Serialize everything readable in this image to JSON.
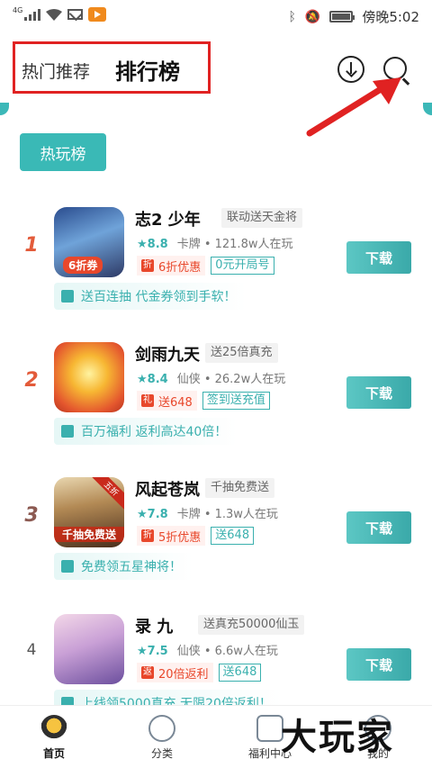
{
  "status_bar": {
    "network": "4G",
    "time": "傍晚5:02",
    "icons": [
      "signal-icon",
      "wifi-icon",
      "mail-icon",
      "app-notification-icon",
      "bluetooth-icon",
      "mute-bell-icon",
      "battery-icon"
    ]
  },
  "header": {
    "tab_hot": "热门推荐",
    "tab_rank": "排行榜",
    "download_icon": "download-circle-icon",
    "search_icon": "search-icon"
  },
  "section": {
    "tab_label": "热玩榜"
  },
  "games": [
    {
      "rank": "1",
      "name": "志2    少年",
      "tag": "联动送天金将",
      "score": "8.8",
      "category": "卡牌 • 121.8w人在玩",
      "perk_icon": "折",
      "perk": "6折优惠",
      "perk_sub": "0元开局号",
      "promo": "送百连抽 代金券领到手软！",
      "icon_text": "6折券",
      "button": "下载"
    },
    {
      "rank": "2",
      "name": "剑雨九天",
      "tag": "送25倍真充",
      "score": "8.4",
      "category": "仙侠 • 26.2w人在玩",
      "perk_icon": "礼",
      "perk": "送648",
      "perk_sub": "签到送充值",
      "promo": "百万福利 返利高达40倍！",
      "icon_text": "",
      "button": "下载"
    },
    {
      "rank": "3",
      "name": "风起苍岚",
      "tag": "千抽免费送",
      "score": "7.8",
      "category": "卡牌 • 1.3w人在玩",
      "perk_icon": "折",
      "perk": "5折优惠",
      "perk_sub": "送648",
      "promo": "免费领五星神将！",
      "icon_text": "千抽免费送",
      "icon_ribbon": "五折",
      "button": "下载"
    },
    {
      "rank": "4",
      "name": "录    九",
      "tag": "送真充50000仙玉",
      "score": "7.5",
      "category": "仙侠 • 6.6w人在玩",
      "perk_icon": "返",
      "perk": "20倍返利",
      "perk_sub": "送648",
      "promo": "上线领5000真充 无限20倍返利！",
      "icon_text": "",
      "button": "下载"
    }
  ],
  "bottom_nav": [
    {
      "label": "首页",
      "icon": "home-icon"
    },
    {
      "label": "分类",
      "icon": "category-icon"
    },
    {
      "label": "福利中心",
      "icon": "welfare-icon"
    },
    {
      "label": "我的",
      "icon": "profile-icon"
    }
  ],
  "watermark": "大玩家",
  "colors": {
    "accent": "#3ab0ae",
    "annotation_red": "#e02222",
    "rank_red": "#e35b3a",
    "perk_red": "#e8472b"
  }
}
